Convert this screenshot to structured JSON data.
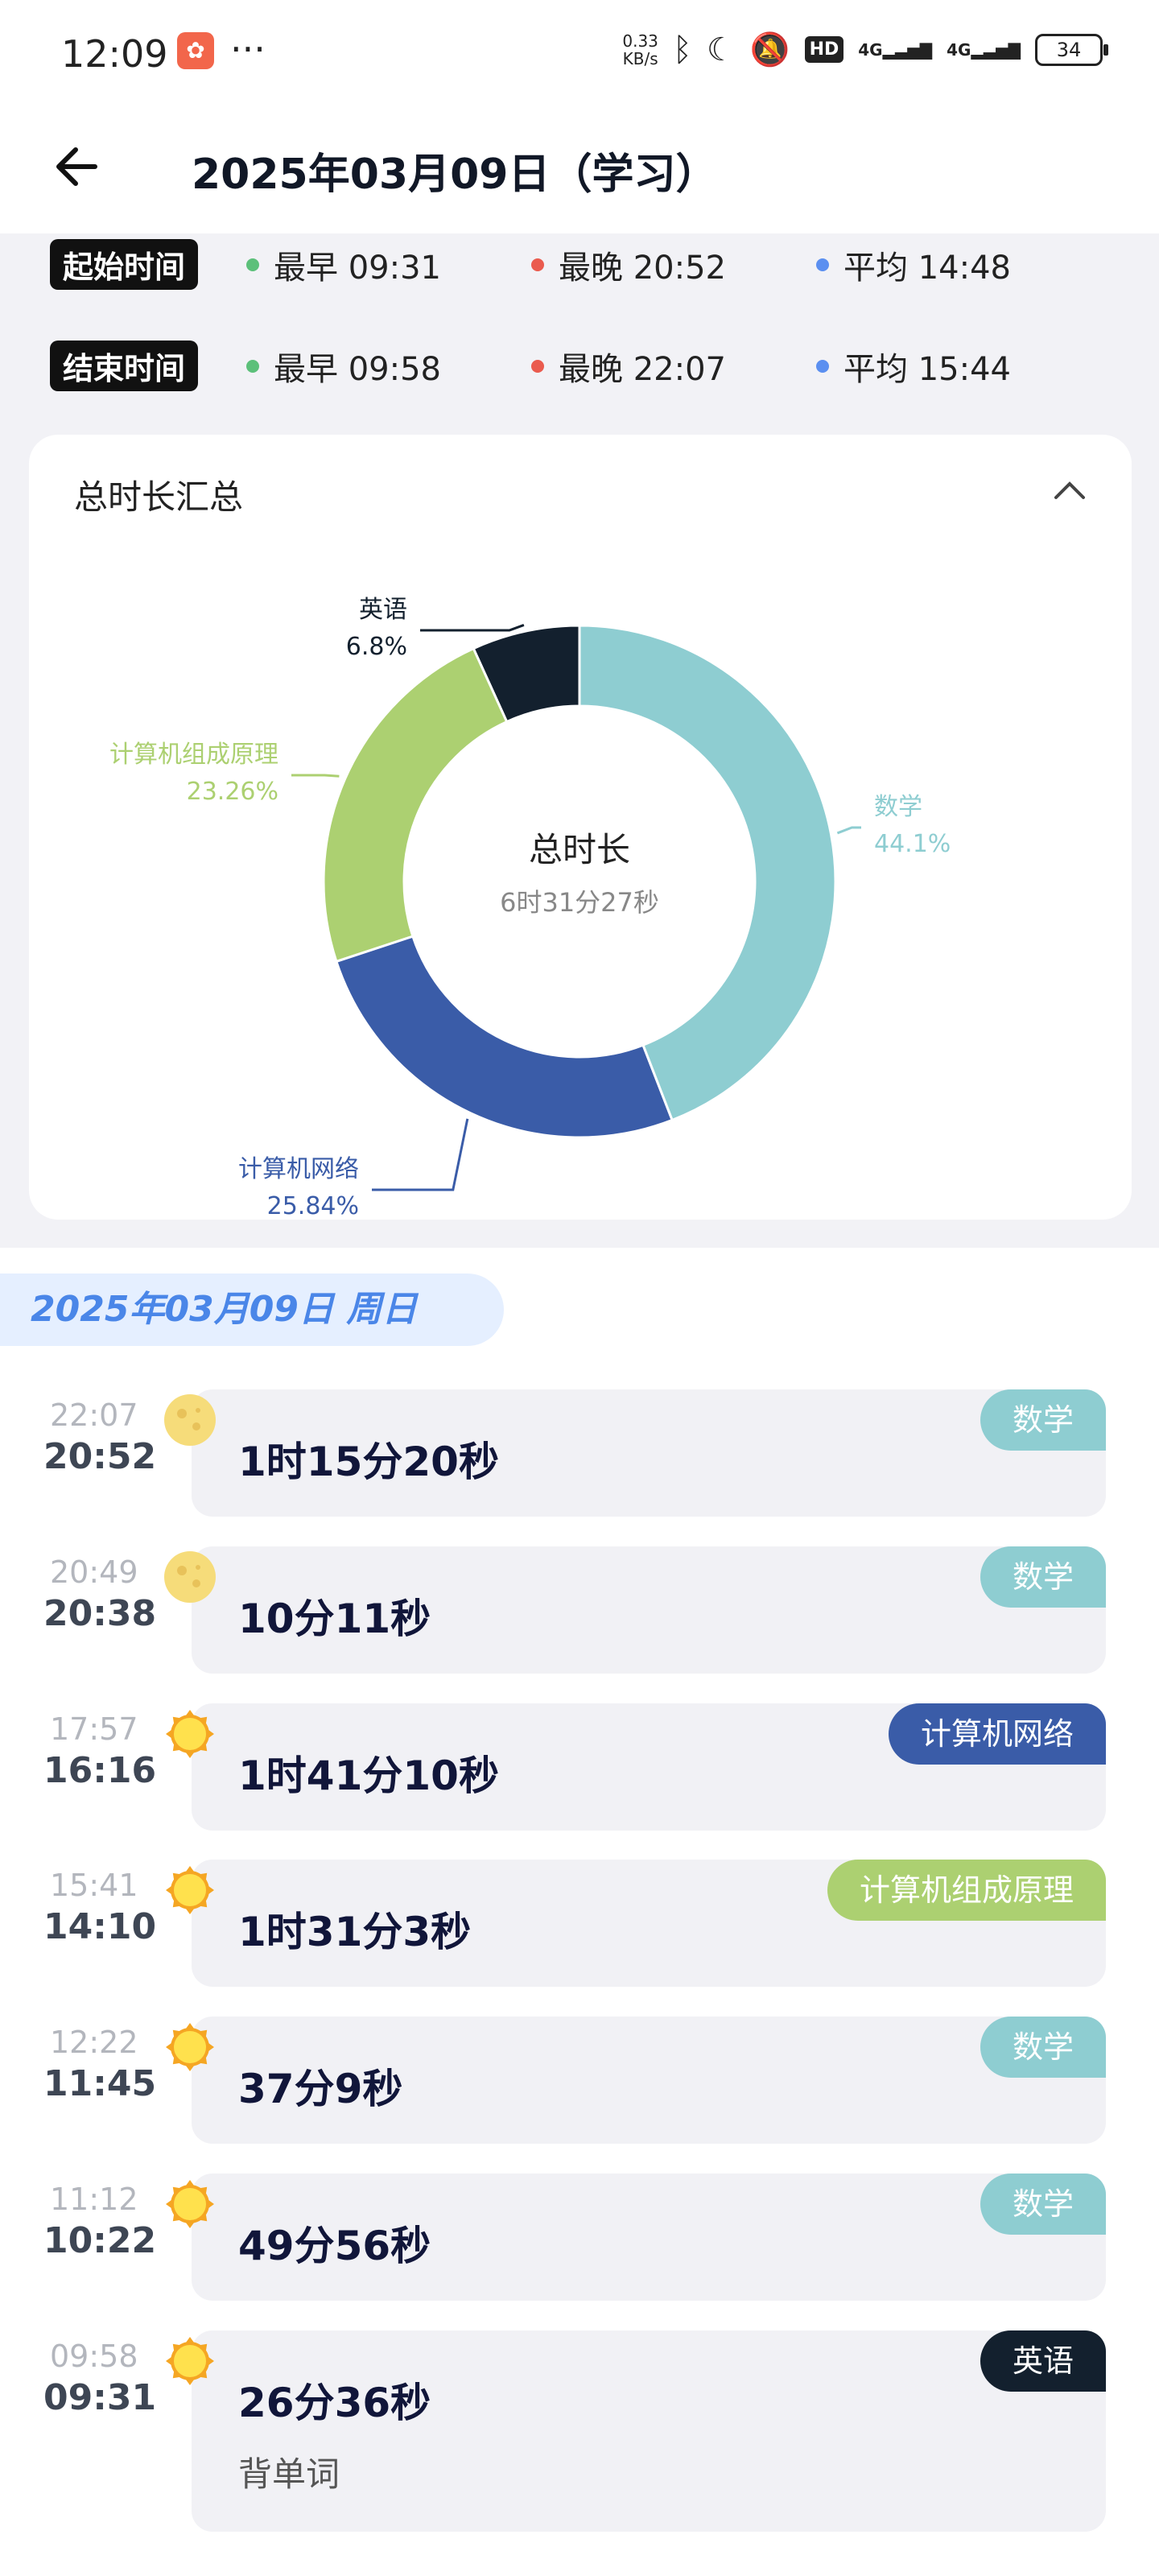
{
  "status_bar": {
    "time": "12:09",
    "app_badge": "",
    "more": "···",
    "net_speed_value": "0.33",
    "net_speed_unit": "KB/s",
    "hd_label": "HD",
    "signal1": "4G",
    "signal2": "4G",
    "battery": "34",
    "icons": [
      "bluetooth-icon",
      "moon-icon",
      "bell-off-icon",
      "signal-icon",
      "battery-icon"
    ]
  },
  "header": {
    "title": "2025年03月09日（学习）",
    "back_icon": "arrow-left-icon"
  },
  "stats": {
    "start": {
      "label": "起始时间",
      "earliest": "最早 09:31",
      "latest": "最晚 20:52",
      "average": "平均 14:48"
    },
    "end": {
      "label": "结束时间",
      "earliest": "最早 09:58",
      "latest": "最晚 22:07",
      "average": "平均 15:44"
    },
    "colors": {
      "earliest": "#5cc07a",
      "latest": "#ea5b4e",
      "average": "#5b8ff0"
    }
  },
  "summary_card": {
    "title": "总时长汇总",
    "collapse_icon": "chevron-up-icon",
    "center_label": "总时长",
    "center_value": "6时31分27秒"
  },
  "chart_data": {
    "type": "pie",
    "title": "",
    "categories": [
      "数学",
      "计算机网络",
      "计算机组成原理",
      "英语"
    ],
    "values": [
      44.1,
      25.84,
      23.26,
      6.8
    ],
    "value_labels": [
      "44.1%",
      "25.84%",
      "23.26%",
      "6.8%"
    ],
    "colors": [
      "#8ecdd1",
      "#3a5ca8",
      "#acd071",
      "#13202e"
    ],
    "donut": true
  },
  "date_header": {
    "text": "2025年03月09日  周日"
  },
  "entries": [
    {
      "end": "22:07",
      "start": "20:52",
      "duration": "1时15分20秒",
      "subject": "数学",
      "color": "#8ecdd1",
      "icon": "moon-icon",
      "note": ""
    },
    {
      "end": "20:49",
      "start": "20:38",
      "duration": "10分11秒",
      "subject": "数学",
      "color": "#8ecdd1",
      "icon": "moon-icon",
      "note": ""
    },
    {
      "end": "17:57",
      "start": "16:16",
      "duration": "1时41分10秒",
      "subject": "计算机网络",
      "color": "#3a5ca8",
      "icon": "sun-icon",
      "note": ""
    },
    {
      "end": "15:41",
      "start": "14:10",
      "duration": "1时31分3秒",
      "subject": "计算机组成原理",
      "color": "#acd071",
      "icon": "sun-icon",
      "note": ""
    },
    {
      "end": "12:22",
      "start": "11:45",
      "duration": "37分9秒",
      "subject": "数学",
      "color": "#8ecdd1",
      "icon": "sun-icon",
      "note": ""
    },
    {
      "end": "11:12",
      "start": "10:22",
      "duration": "49分56秒",
      "subject": "数学",
      "color": "#8ecdd1",
      "icon": "sun-icon",
      "note": ""
    },
    {
      "end": "09:58",
      "start": "09:31",
      "duration": "26分36秒",
      "subject": "英语",
      "color": "#13202e",
      "icon": "sun-icon",
      "note": "背单词"
    }
  ]
}
